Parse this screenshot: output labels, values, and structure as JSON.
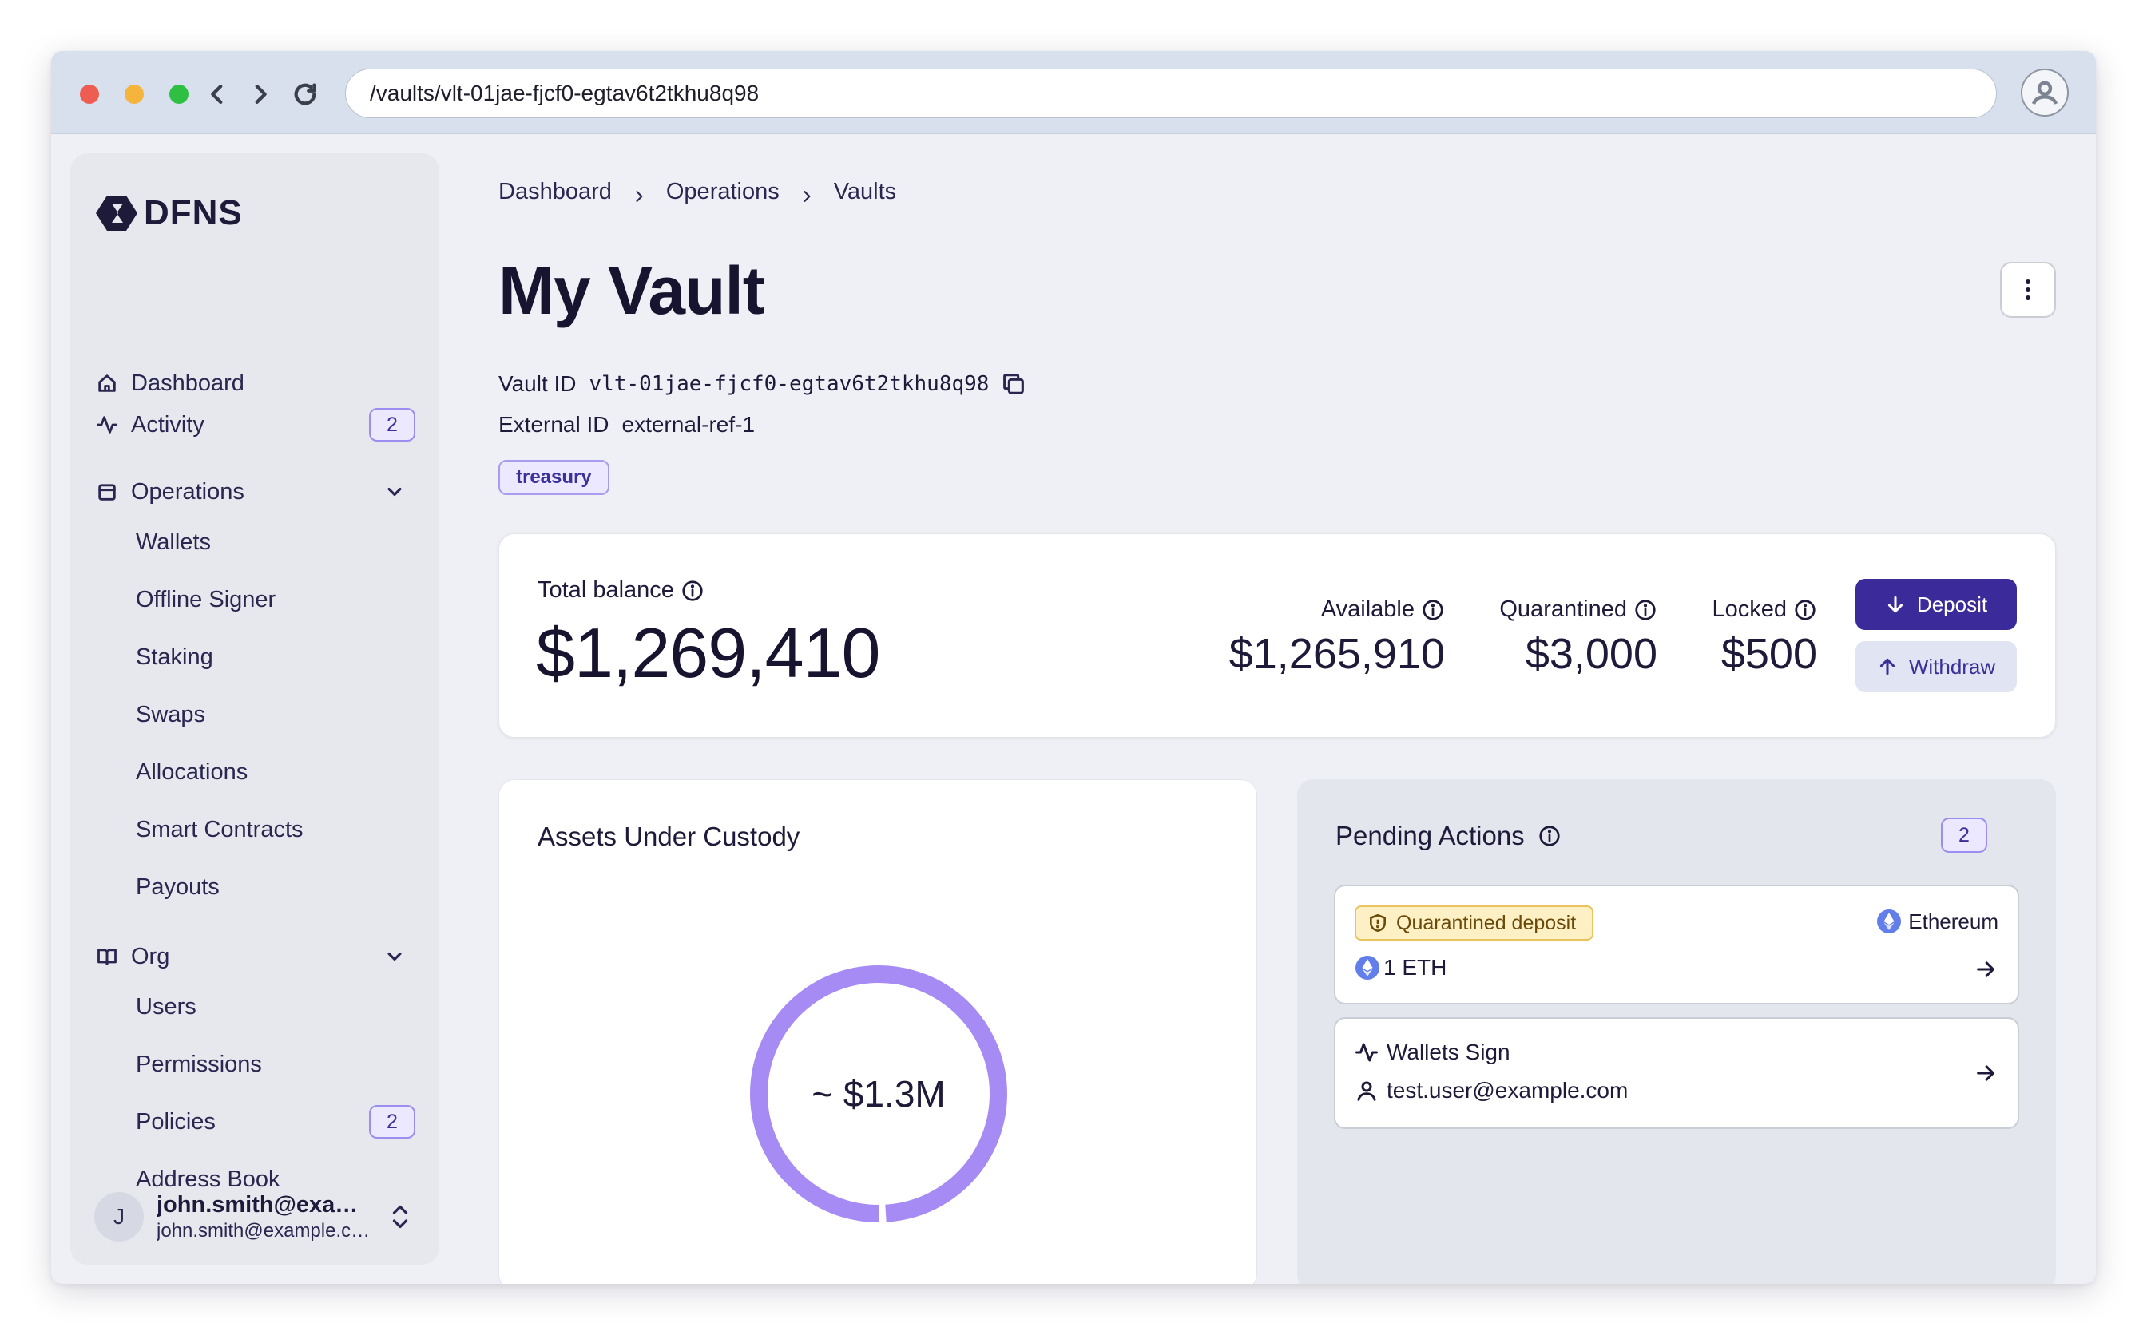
{
  "browser": {
    "url": "/vaults/vlt-01jae-fjcf0-egtav6t2tkhu8q98",
    "traffic_lights": [
      "#ee5c52",
      "#f5b43b",
      "#2fc043"
    ]
  },
  "sidebar": {
    "logo_text": "DFNS",
    "items": [
      {
        "label": "Dashboard",
        "icon": "home-icon"
      },
      {
        "label": "Activity",
        "icon": "activity-icon",
        "badge": "2"
      },
      {
        "label": "Operations",
        "icon": "calendar-icon",
        "expanded": true
      },
      {
        "label": "Org",
        "icon": "book-icon",
        "expanded": true
      }
    ],
    "operations_sub": [
      "Wallets",
      "Offline Signer",
      "Staking",
      "Swaps",
      "Allocations",
      "Smart Contracts",
      "Payouts"
    ],
    "org_sub": [
      {
        "label": "Users"
      },
      {
        "label": "Permissions"
      },
      {
        "label": "Policies",
        "badge": "2"
      },
      {
        "label": "Address Book"
      }
    ],
    "user": {
      "initial": "J",
      "name": "john.smith@example.com",
      "email": "john.smith@example.com"
    }
  },
  "breadcrumb": [
    "Dashboard",
    "Operations",
    "Vaults"
  ],
  "page": {
    "title": "My Vault",
    "vault_id_label": "Vault ID",
    "vault_id": "vlt-01jae-fjcf0-egtav6t2tkhu8q98",
    "external_id_label": "External ID",
    "external_id": "external-ref-1",
    "tag": "treasury"
  },
  "balance": {
    "total_label": "Total balance",
    "total_value": "$1,269,410",
    "available_label": "Available",
    "available_value": "$1,265,910",
    "quarantined_label": "Quarantined",
    "quarantined_value": "$3,000",
    "locked_label": "Locked",
    "locked_value": "$500",
    "deposit_label": "Deposit",
    "withdraw_label": "Withdraw"
  },
  "assets": {
    "title": "Assets Under Custody",
    "center_label": "~ $1.3M",
    "ring_fraction": 0.99,
    "ring_color": "#a78bf5"
  },
  "pending": {
    "title": "Pending Actions",
    "count": "2",
    "actions": [
      {
        "badge": "Quarantined deposit",
        "chain": "Ethereum",
        "amount": "1 ETH"
      },
      {
        "title": "Wallets Sign",
        "user": "test.user@example.com"
      }
    ]
  },
  "colors": {
    "accent": "#3a2a9a",
    "badge_border": "#9b8ef0",
    "warning_bg": "#fdf0c4"
  }
}
